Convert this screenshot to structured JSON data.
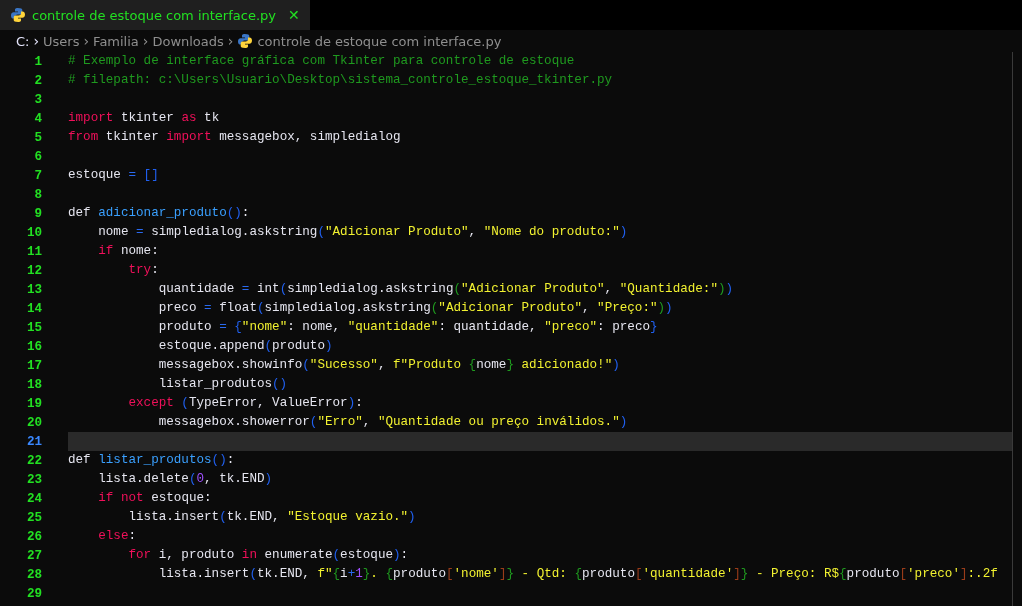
{
  "tab": {
    "title": "controle de estoque com interface.py",
    "close": "✕",
    "selected": true
  },
  "breadcrumb": [
    "C:",
    "Users",
    "Familia",
    "Downloads",
    "controle de estoque com interface.py"
  ],
  "breadcrumb_separator": "›",
  "lines": [
    {
      "number": "1",
      "current": false,
      "tokens": [
        {
          "kind": "comment",
          "text": "# Exemplo de interface gráfica com Tkinter para controle de estoque"
        }
      ]
    },
    {
      "number": "2",
      "current": false,
      "tokens": [
        {
          "kind": "comment",
          "text": "# filepath: c:\\Users\\Usuario\\Desktop\\sistema_controle_estoque_tkinter.py"
        }
      ]
    },
    {
      "number": "3",
      "current": false
    },
    {
      "number": "4",
      "current": false,
      "tokens": [
        {
          "kind": "keyword",
          "text": "import"
        },
        {
          "kind": "plain",
          "text": " tkinter "
        },
        {
          "kind": "keyword",
          "text": "as"
        },
        {
          "kind": "plain",
          "text": " tk"
        }
      ]
    },
    {
      "number": "5",
      "current": false,
      "tokens": [
        {
          "kind": "keyword",
          "text": "from"
        },
        {
          "kind": "plain",
          "text": " tkinter "
        },
        {
          "kind": "keyword",
          "text": "import"
        },
        {
          "kind": "plain",
          "text": " messagebox, simpledialog"
        }
      ]
    },
    {
      "number": "6",
      "current": false
    },
    {
      "number": "7",
      "current": false,
      "tokens": [
        {
          "kind": "plain",
          "text": "estoque "
        },
        {
          "kind": "operator",
          "text": "="
        },
        {
          "kind": "bracket1",
          "text": " []"
        }
      ]
    },
    {
      "number": "8",
      "current": false
    },
    {
      "number": "9",
      "current": false,
      "tokens": [
        {
          "kind": "plain",
          "text": "def "
        },
        {
          "kind": "function",
          "text": "adicionar_produto"
        },
        {
          "kind": "bracket1",
          "text": "()"
        },
        {
          "kind": "plain",
          "text": ":"
        }
      ]
    },
    {
      "number": "10",
      "current": false,
      "tokens": [
        {
          "kind": "plain",
          "text": "    nome "
        },
        {
          "kind": "operator",
          "text": "="
        },
        {
          "kind": "plain",
          "text": " simpledialog.askstring"
        },
        {
          "kind": "bracket1",
          "text": "("
        },
        {
          "kind": "string",
          "text": "\"Adicionar Produto\""
        },
        {
          "kind": "plain",
          "text": ", "
        },
        {
          "kind": "string",
          "text": "\"Nome do produto:\""
        },
        {
          "kind": "bracket1",
          "text": ")"
        }
      ]
    },
    {
      "number": "11",
      "current": false,
      "tokens": [
        {
          "kind": "keyword",
          "text": "    if"
        },
        {
          "kind": "plain",
          "text": " nome:"
        }
      ]
    },
    {
      "number": "12",
      "current": false,
      "tokens": [
        {
          "kind": "keyword",
          "text": "        try"
        },
        {
          "kind": "plain",
          "text": ":"
        }
      ]
    },
    {
      "number": "13",
      "current": false,
      "tokens": [
        {
          "kind": "plain",
          "text": "            quantidade "
        },
        {
          "kind": "operator",
          "text": "="
        },
        {
          "kind": "plain",
          "text": " int"
        },
        {
          "kind": "bracket1",
          "text": "("
        },
        {
          "kind": "plain",
          "text": "simpledialog.askstring"
        },
        {
          "kind": "bracket2",
          "text": "("
        },
        {
          "kind": "string",
          "text": "\"Adicionar Produto\""
        },
        {
          "kind": "plain",
          "text": ", "
        },
        {
          "kind": "string",
          "text": "\"Quantidade:\""
        },
        {
          "kind": "bracket2",
          "text": ")"
        },
        {
          "kind": "bracket1",
          "text": ")"
        }
      ]
    },
    {
      "number": "14",
      "current": false,
      "tokens": [
        {
          "kind": "plain",
          "text": "            preco "
        },
        {
          "kind": "operator",
          "text": "="
        },
        {
          "kind": "plain",
          "text": " float"
        },
        {
          "kind": "bracket1",
          "text": "("
        },
        {
          "kind": "plain",
          "text": "simpledialog.askstring"
        },
        {
          "kind": "bracket2",
          "text": "("
        },
        {
          "kind": "string",
          "text": "\"Adicionar Produto\""
        },
        {
          "kind": "plain",
          "text": ", "
        },
        {
          "kind": "string",
          "text": "\"Preço:\""
        },
        {
          "kind": "bracket2",
          "text": ")"
        },
        {
          "kind": "bracket1",
          "text": ")"
        }
      ]
    },
    {
      "number": "15",
      "current": false,
      "tokens": [
        {
          "kind": "plain",
          "text": "            produto "
        },
        {
          "kind": "operator",
          "text": "="
        },
        {
          "kind": "bracket1",
          "text": " {"
        },
        {
          "kind": "string",
          "text": "\"nome\""
        },
        {
          "kind": "plain",
          "text": ": nome, "
        },
        {
          "kind": "string",
          "text": "\"quantidade\""
        },
        {
          "kind": "plain",
          "text": ": quantidade, "
        },
        {
          "kind": "string",
          "text": "\"preco\""
        },
        {
          "kind": "plain",
          "text": ": preco"
        },
        {
          "kind": "bracket1",
          "text": "}"
        }
      ]
    },
    {
      "number": "16",
      "current": false,
      "tokens": [
        {
          "kind": "plain",
          "text": "            estoque.append"
        },
        {
          "kind": "bracket1",
          "text": "("
        },
        {
          "kind": "plain",
          "text": "produto"
        },
        {
          "kind": "bracket1",
          "text": ")"
        }
      ]
    },
    {
      "number": "17",
      "current": false,
      "tokens": [
        {
          "kind": "plain",
          "text": "            messagebox.showinfo"
        },
        {
          "kind": "bracket1",
          "text": "("
        },
        {
          "kind": "string",
          "text": "\"Sucesso\""
        },
        {
          "kind": "plain",
          "text": ", "
        },
        {
          "kind": "string",
          "text": "f\"Produto "
        },
        {
          "kind": "bracket2",
          "text": "{"
        },
        {
          "kind": "plain",
          "text": "nome"
        },
        {
          "kind": "bracket2",
          "text": "}"
        },
        {
          "kind": "string",
          "text": " adicionado!\""
        },
        {
          "kind": "bracket1",
          "text": ")"
        }
      ]
    },
    {
      "number": "18",
      "current": false,
      "tokens": [
        {
          "kind": "plain",
          "text": "            listar_produtos"
        },
        {
          "kind": "bracket1",
          "text": "()"
        }
      ]
    },
    {
      "number": "19",
      "current": false,
      "tokens": [
        {
          "kind": "keyword",
          "text": "        except"
        },
        {
          "kind": "bracket1",
          "text": " ("
        },
        {
          "kind": "plain",
          "text": "TypeError, ValueError"
        },
        {
          "kind": "bracket1",
          "text": ")"
        },
        {
          "kind": "plain",
          "text": ":"
        }
      ]
    },
    {
      "number": "20",
      "current": false,
      "tokens": [
        {
          "kind": "plain",
          "text": "            messagebox.showerror"
        },
        {
          "kind": "bracket1",
          "text": "("
        },
        {
          "kind": "string",
          "text": "\"Erro\""
        },
        {
          "kind": "plain",
          "text": ", "
        },
        {
          "kind": "string",
          "text": "\"Quantidade ou preço inválidos.\""
        },
        {
          "kind": "bracket1",
          "text": ")"
        }
      ]
    },
    {
      "number": "21",
      "current": true
    },
    {
      "number": "22",
      "current": false,
      "tokens": [
        {
          "kind": "plain",
          "text": "def "
        },
        {
          "kind": "function",
          "text": "listar_produtos"
        },
        {
          "kind": "bracket1",
          "text": "()"
        },
        {
          "kind": "plain",
          "text": ":"
        }
      ]
    },
    {
      "number": "23",
      "current": false,
      "tokens": [
        {
          "kind": "plain",
          "text": "    lista.delete"
        },
        {
          "kind": "bracket1",
          "text": "("
        },
        {
          "kind": "number",
          "text": "0"
        },
        {
          "kind": "plain",
          "text": ", tk.END"
        },
        {
          "kind": "bracket1",
          "text": ")"
        }
      ]
    },
    {
      "number": "24",
      "current": false,
      "tokens": [
        {
          "kind": "keyword",
          "text": "    if"
        },
        {
          "kind": "keyword",
          "text": " not"
        },
        {
          "kind": "plain",
          "text": " estoque:"
        }
      ]
    },
    {
      "number": "25",
      "current": false,
      "tokens": [
        {
          "kind": "plain",
          "text": "        lista.insert"
        },
        {
          "kind": "bracket1",
          "text": "("
        },
        {
          "kind": "plain",
          "text": "tk.END, "
        },
        {
          "kind": "string",
          "text": "\"Estoque vazio.\""
        },
        {
          "kind": "bracket1",
          "text": ")"
        }
      ]
    },
    {
      "number": "26",
      "current": false,
      "tokens": [
        {
          "kind": "keyword",
          "text": "    else"
        },
        {
          "kind": "plain",
          "text": ":"
        }
      ]
    },
    {
      "number": "27",
      "current": false,
      "tokens": [
        {
          "kind": "keyword",
          "text": "        for"
        },
        {
          "kind": "plain",
          "text": " i, produto "
        },
        {
          "kind": "keyword",
          "text": "in"
        },
        {
          "kind": "plain",
          "text": " enumerate"
        },
        {
          "kind": "bracket1",
          "text": "("
        },
        {
          "kind": "plain",
          "text": "estoque"
        },
        {
          "kind": "bracket1",
          "text": ")"
        },
        {
          "kind": "plain",
          "text": ":"
        }
      ]
    },
    {
      "number": "28",
      "current": false,
      "tokens": [
        {
          "kind": "plain",
          "text": "            lista.insert"
        },
        {
          "kind": "bracket1",
          "text": "("
        },
        {
          "kind": "plain",
          "text": "tk.END, "
        },
        {
          "kind": "string",
          "text": "f\""
        },
        {
          "kind": "bracket2",
          "text": "{"
        },
        {
          "kind": "plain",
          "text": "i"
        },
        {
          "kind": "operator",
          "text": "+"
        },
        {
          "kind": "number",
          "text": "1"
        },
        {
          "kind": "bracket2",
          "text": "}"
        },
        {
          "kind": "string",
          "text": ". "
        },
        {
          "kind": "bracket2",
          "text": "{"
        },
        {
          "kind": "plain",
          "text": "produto"
        },
        {
          "kind": "bracket3",
          "text": "["
        },
        {
          "kind": "string",
          "text": "'nome'"
        },
        {
          "kind": "bracket3",
          "text": "]"
        },
        {
          "kind": "bracket2",
          "text": "}"
        },
        {
          "kind": "string",
          "text": " - Qtd: "
        },
        {
          "kind": "bracket2",
          "text": "{"
        },
        {
          "kind": "plain",
          "text": "produto"
        },
        {
          "kind": "bracket3",
          "text": "["
        },
        {
          "kind": "string",
          "text": "'quantidade'"
        },
        {
          "kind": "bracket3",
          "text": "]"
        },
        {
          "kind": "bracket2",
          "text": "}"
        },
        {
          "kind": "string",
          "text": " - Preço: R$"
        },
        {
          "kind": "bracket2",
          "text": "{"
        },
        {
          "kind": "plain",
          "text": "produto"
        },
        {
          "kind": "bracket3",
          "text": "["
        },
        {
          "kind": "string",
          "text": "'preco'"
        },
        {
          "kind": "bracket3",
          "text": "]"
        },
        {
          "kind": "string",
          "text": ":.2f"
        }
      ]
    },
    {
      "number": "29",
      "current": false
    }
  ]
}
